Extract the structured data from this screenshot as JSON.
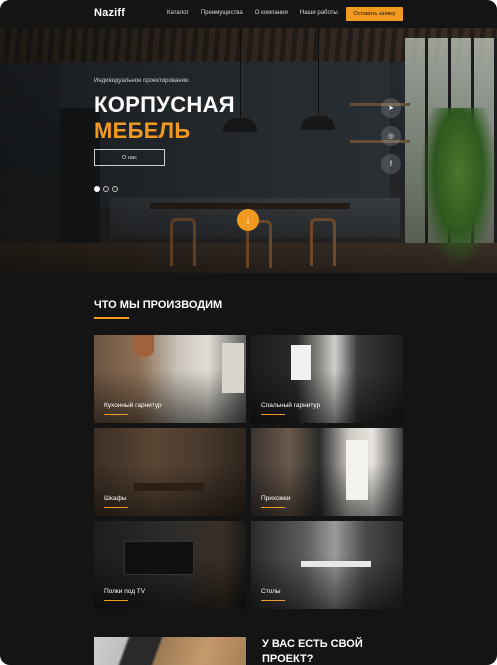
{
  "header": {
    "logo": "Naziff",
    "menu": [
      "Каталог",
      "Преимущества",
      "О компании",
      "Наши работы"
    ],
    "cta": "Оставить заявку"
  },
  "hero": {
    "subtitle": "Индивидуальное проектирование.",
    "title_line1": "КОРПУСНАЯ",
    "title_line2": "МЕБЕЛЬ",
    "button": "О нас",
    "slides": 3,
    "active_slide": 1,
    "socials": [
      "telegram-icon",
      "instagram-icon",
      "facebook-icon"
    ],
    "social_glyphs": [
      "➤",
      "◎",
      "f"
    ],
    "scroll_glyph": "↓"
  },
  "products": {
    "title": "ЧТО МЫ ПРОИЗВОДИМ",
    "items": [
      {
        "label": "Кухонный гарнитур"
      },
      {
        "label": "Спальный гарнитур"
      },
      {
        "label": "Шкафы"
      },
      {
        "label": "Прихожки"
      },
      {
        "label": "Полки под TV"
      },
      {
        "label": "Столы"
      }
    ]
  },
  "project": {
    "title": "У ВАС ЕСТЬ СВОЙ ПРОЕКТ?"
  },
  "colors": {
    "accent": "#f29a1f",
    "background": "#141414"
  }
}
